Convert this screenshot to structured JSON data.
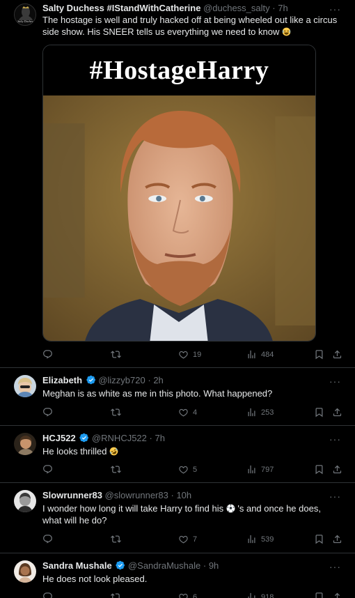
{
  "tweets": [
    {
      "name": "Salty Duchess #IStandWithCatherine",
      "handle": "@duchess_salty",
      "dot": "·",
      "time": "7h",
      "text": "The hostage is well and truly hacked off at being wheeled out like a circus side show. His SNEER tells us everything we need to know",
      "media_title": "#HostageHarry",
      "avatar_text": "Salty Duchess",
      "replies": "",
      "retweets": "",
      "likes": "19",
      "views": "484"
    },
    {
      "name": "Elizabeth",
      "handle": "@lizzyb720",
      "dot": "·",
      "time": "2h",
      "text": "Meghan is as white as me in this photo. What happened?",
      "replies": "",
      "retweets": "",
      "likes": "4",
      "views": "253"
    },
    {
      "name": "HCJ522",
      "handle": "@RNHCJ522",
      "dot": "·",
      "time": "7h",
      "text": "He looks thrilled",
      "replies": "",
      "retweets": "",
      "likes": "5",
      "views": "797"
    },
    {
      "name": "Slowrunner83",
      "handle": "@slowrunner83",
      "dot": "·",
      "time": "10h",
      "text_before": "I wonder how long it will take Harry to find his",
      "text_after": "'s and once he does, what will he do?",
      "replies": "",
      "retweets": "",
      "likes": "7",
      "views": "539"
    },
    {
      "name": "Sandra Mushale",
      "handle": "@SandraMushale",
      "dot": "·",
      "time": "9h",
      "text": "He does not look pleased.",
      "replies": "",
      "retweets": "",
      "likes": "6",
      "views": "918"
    }
  ],
  "more_label": "···",
  "colors": {
    "bg": "#000000",
    "text": "#e7e9ea",
    "muted": "#71767b",
    "verified": "#1d9bf0",
    "divider": "#2f3336"
  },
  "icons": [
    "reply-icon",
    "retweet-icon",
    "like-icon",
    "views-icon",
    "bookmark-icon",
    "share-icon",
    "verified-badge-icon",
    "more-icon",
    "laughing-emoji",
    "rofl-emoji",
    "soccer-ball-emoji"
  ]
}
